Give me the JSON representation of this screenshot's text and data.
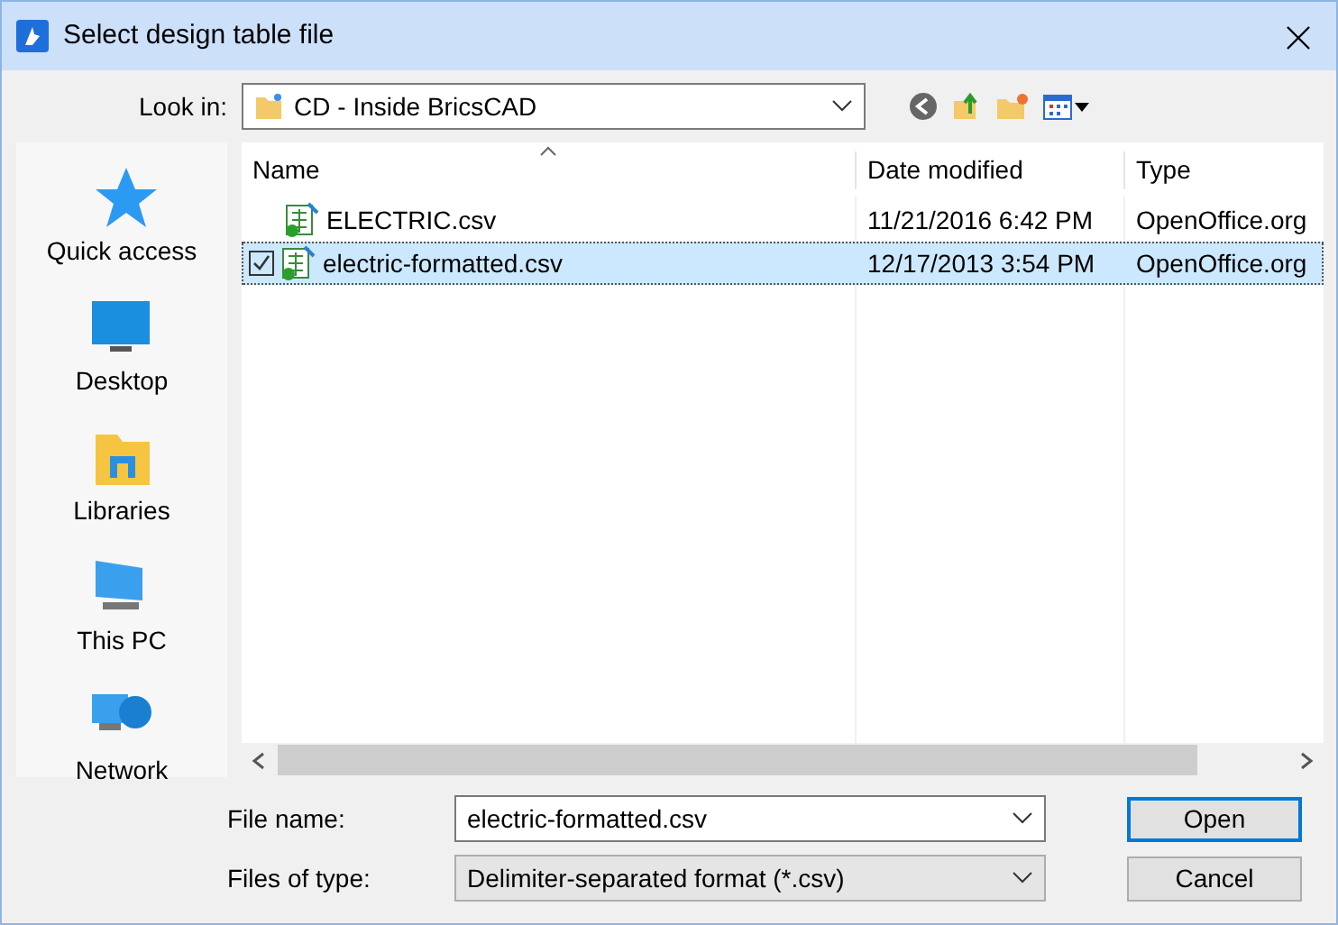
{
  "window": {
    "title": "Select design table file"
  },
  "look_in": {
    "label": "Look in:",
    "value": "CD - Inside BricsCAD"
  },
  "places": [
    {
      "label": "Quick access",
      "kind": "star"
    },
    {
      "label": "Desktop",
      "kind": "desktop"
    },
    {
      "label": "Libraries",
      "kind": "libraries"
    },
    {
      "label": "This PC",
      "kind": "pc"
    },
    {
      "label": "Network",
      "kind": "network"
    }
  ],
  "file_list": {
    "columns": [
      "Name",
      "Date modified",
      "Type"
    ],
    "rows": [
      {
        "name": "ELECTRIC.csv",
        "date": "11/21/2016 6:42 PM",
        "type": "OpenOffice.org",
        "selected": false
      },
      {
        "name": "electric-formatted.csv",
        "date": "12/17/2013 3:54 PM",
        "type": "OpenOffice.org",
        "selected": true
      }
    ]
  },
  "file_name": {
    "label": "File name:",
    "value": "electric-formatted.csv"
  },
  "file_type": {
    "label": "Files of type:",
    "value": "Delimiter-separated format (*.csv)"
  },
  "buttons": [
    "Open",
    "Cancel"
  ]
}
